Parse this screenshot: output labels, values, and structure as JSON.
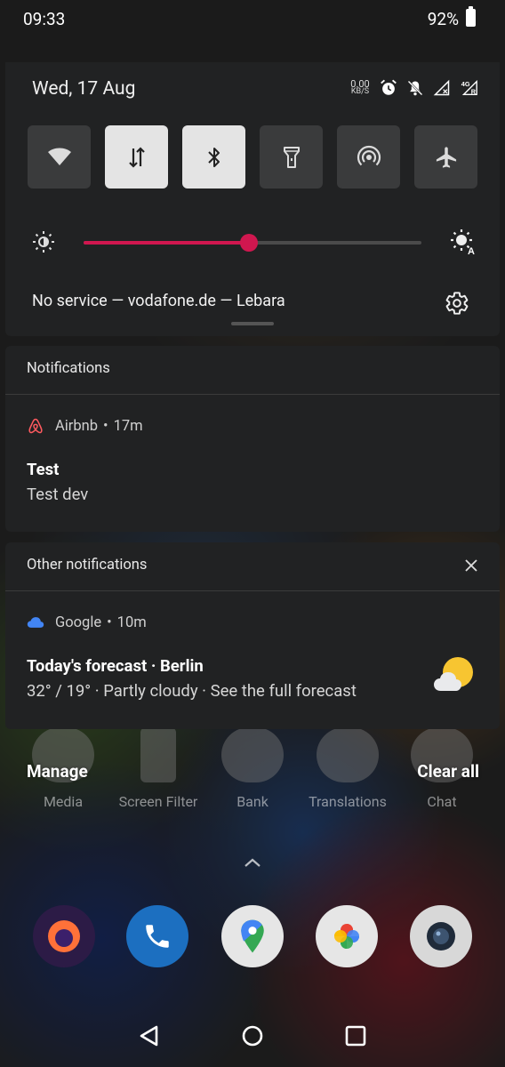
{
  "status_bar": {
    "time": "09:33",
    "battery": "92%"
  },
  "quick_settings": {
    "date": "Wed, 17 Aug",
    "net_speed_value": "0.00",
    "net_speed_unit": "KB/S",
    "network_type": "4G",
    "tiles": [
      {
        "name": "wifi",
        "icon": "wifi-icon",
        "on": false
      },
      {
        "name": "mobile-data",
        "icon": "data-transfer-icon",
        "on": true
      },
      {
        "name": "bluetooth",
        "icon": "bluetooth-icon",
        "on": true
      },
      {
        "name": "flashlight",
        "icon": "flashlight-icon",
        "on": false
      },
      {
        "name": "hotspot",
        "icon": "hotspot-icon",
        "on": false
      },
      {
        "name": "airplane",
        "icon": "airplane-icon",
        "on": false
      }
    ],
    "brightness_percent": 49,
    "carrier_text": "No service — vodafone.de — Lebara",
    "accent_color": "#d0174f"
  },
  "notifications_card": {
    "title": "Notifications",
    "item": {
      "app": "Airbnb",
      "separator": "•",
      "time": "17m",
      "title": "Test",
      "text": "Test dev",
      "app_color": "#ff5a5f"
    }
  },
  "other_card": {
    "title": "Other notifications",
    "item": {
      "app": "Google",
      "separator": "•",
      "time": "10m",
      "title": "Today's forecast · Berlin",
      "text": "32° / 19° · Partly cloudy · See the full forecast",
      "app_color": "#4285f4"
    }
  },
  "actions": {
    "manage": "Manage",
    "clear_all": "Clear all"
  },
  "home": {
    "apps": [
      "Media",
      "Screen Filter",
      "Bank",
      "Translations",
      "Chat"
    ]
  }
}
